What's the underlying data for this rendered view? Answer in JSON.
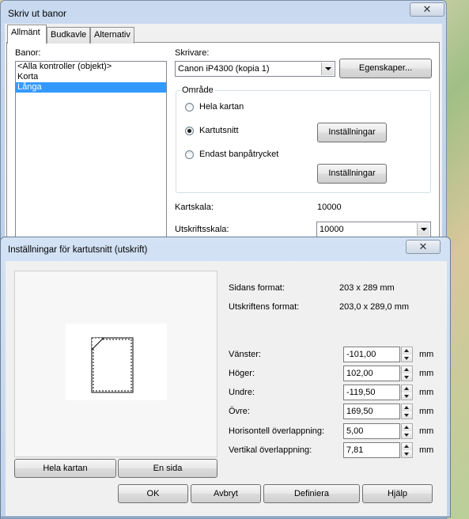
{
  "print_dialog": {
    "title": "Skriv ut banor",
    "close_symbol": "✕",
    "tabs": [
      {
        "label": "Allmänt",
        "active": true
      },
      {
        "label": "Budkavle",
        "active": false
      },
      {
        "label": "Alternativ",
        "active": false
      }
    ],
    "courses_label": "Banor:",
    "courses": [
      {
        "label": "<Alla kontroller (objekt)>",
        "selected": false
      },
      {
        "label": "Korta",
        "selected": false
      },
      {
        "label": "Långa",
        "selected": true
      }
    ],
    "printer_label": "Skrivare:",
    "printer_value": "Canon iP4300 (kopia 1)",
    "properties_button": "Egenskaper...",
    "area_group_label": "Område",
    "area_options": [
      {
        "label": "Hela kartan",
        "checked": false
      },
      {
        "label": "Kartutsnitt",
        "checked": true
      },
      {
        "label": "Endast banpåtrycket",
        "checked": false
      }
    ],
    "settings_button": "Inställningar",
    "map_scale_label": "Kartskala:",
    "map_scale_value": "10000",
    "print_scale_label": "Utskriftsskala:",
    "print_scale_value": "10000"
  },
  "section_dialog": {
    "title": "Inställningar för kartutsnitt (utskrift)",
    "close_symbol": "✕",
    "page_format_label": "Sidans format:",
    "page_format_value": "203 x 289 mm",
    "print_format_label": "Utskriftens format:",
    "print_format_value": "203,0 x 289,0 mm",
    "fields": [
      {
        "label": "Vänster:",
        "value": "-101,00",
        "unit": "mm"
      },
      {
        "label": "Höger:",
        "value": "102,00",
        "unit": "mm"
      },
      {
        "label": "Undre:",
        "value": "-119,50",
        "unit": "mm"
      },
      {
        "label": "Övre:",
        "value": "169,50",
        "unit": "mm"
      },
      {
        "label": "Horisontell överlappning:",
        "value": "5,00",
        "unit": "mm"
      },
      {
        "label": "Vertikal överlappning:",
        "value": "7,81",
        "unit": "mm"
      }
    ],
    "whole_map_button": "Hela kartan",
    "one_page_button": "En sida",
    "ok_button": "OK",
    "cancel_button": "Avbryt",
    "define_button": "Definiera",
    "help_button": "Hjälp"
  }
}
